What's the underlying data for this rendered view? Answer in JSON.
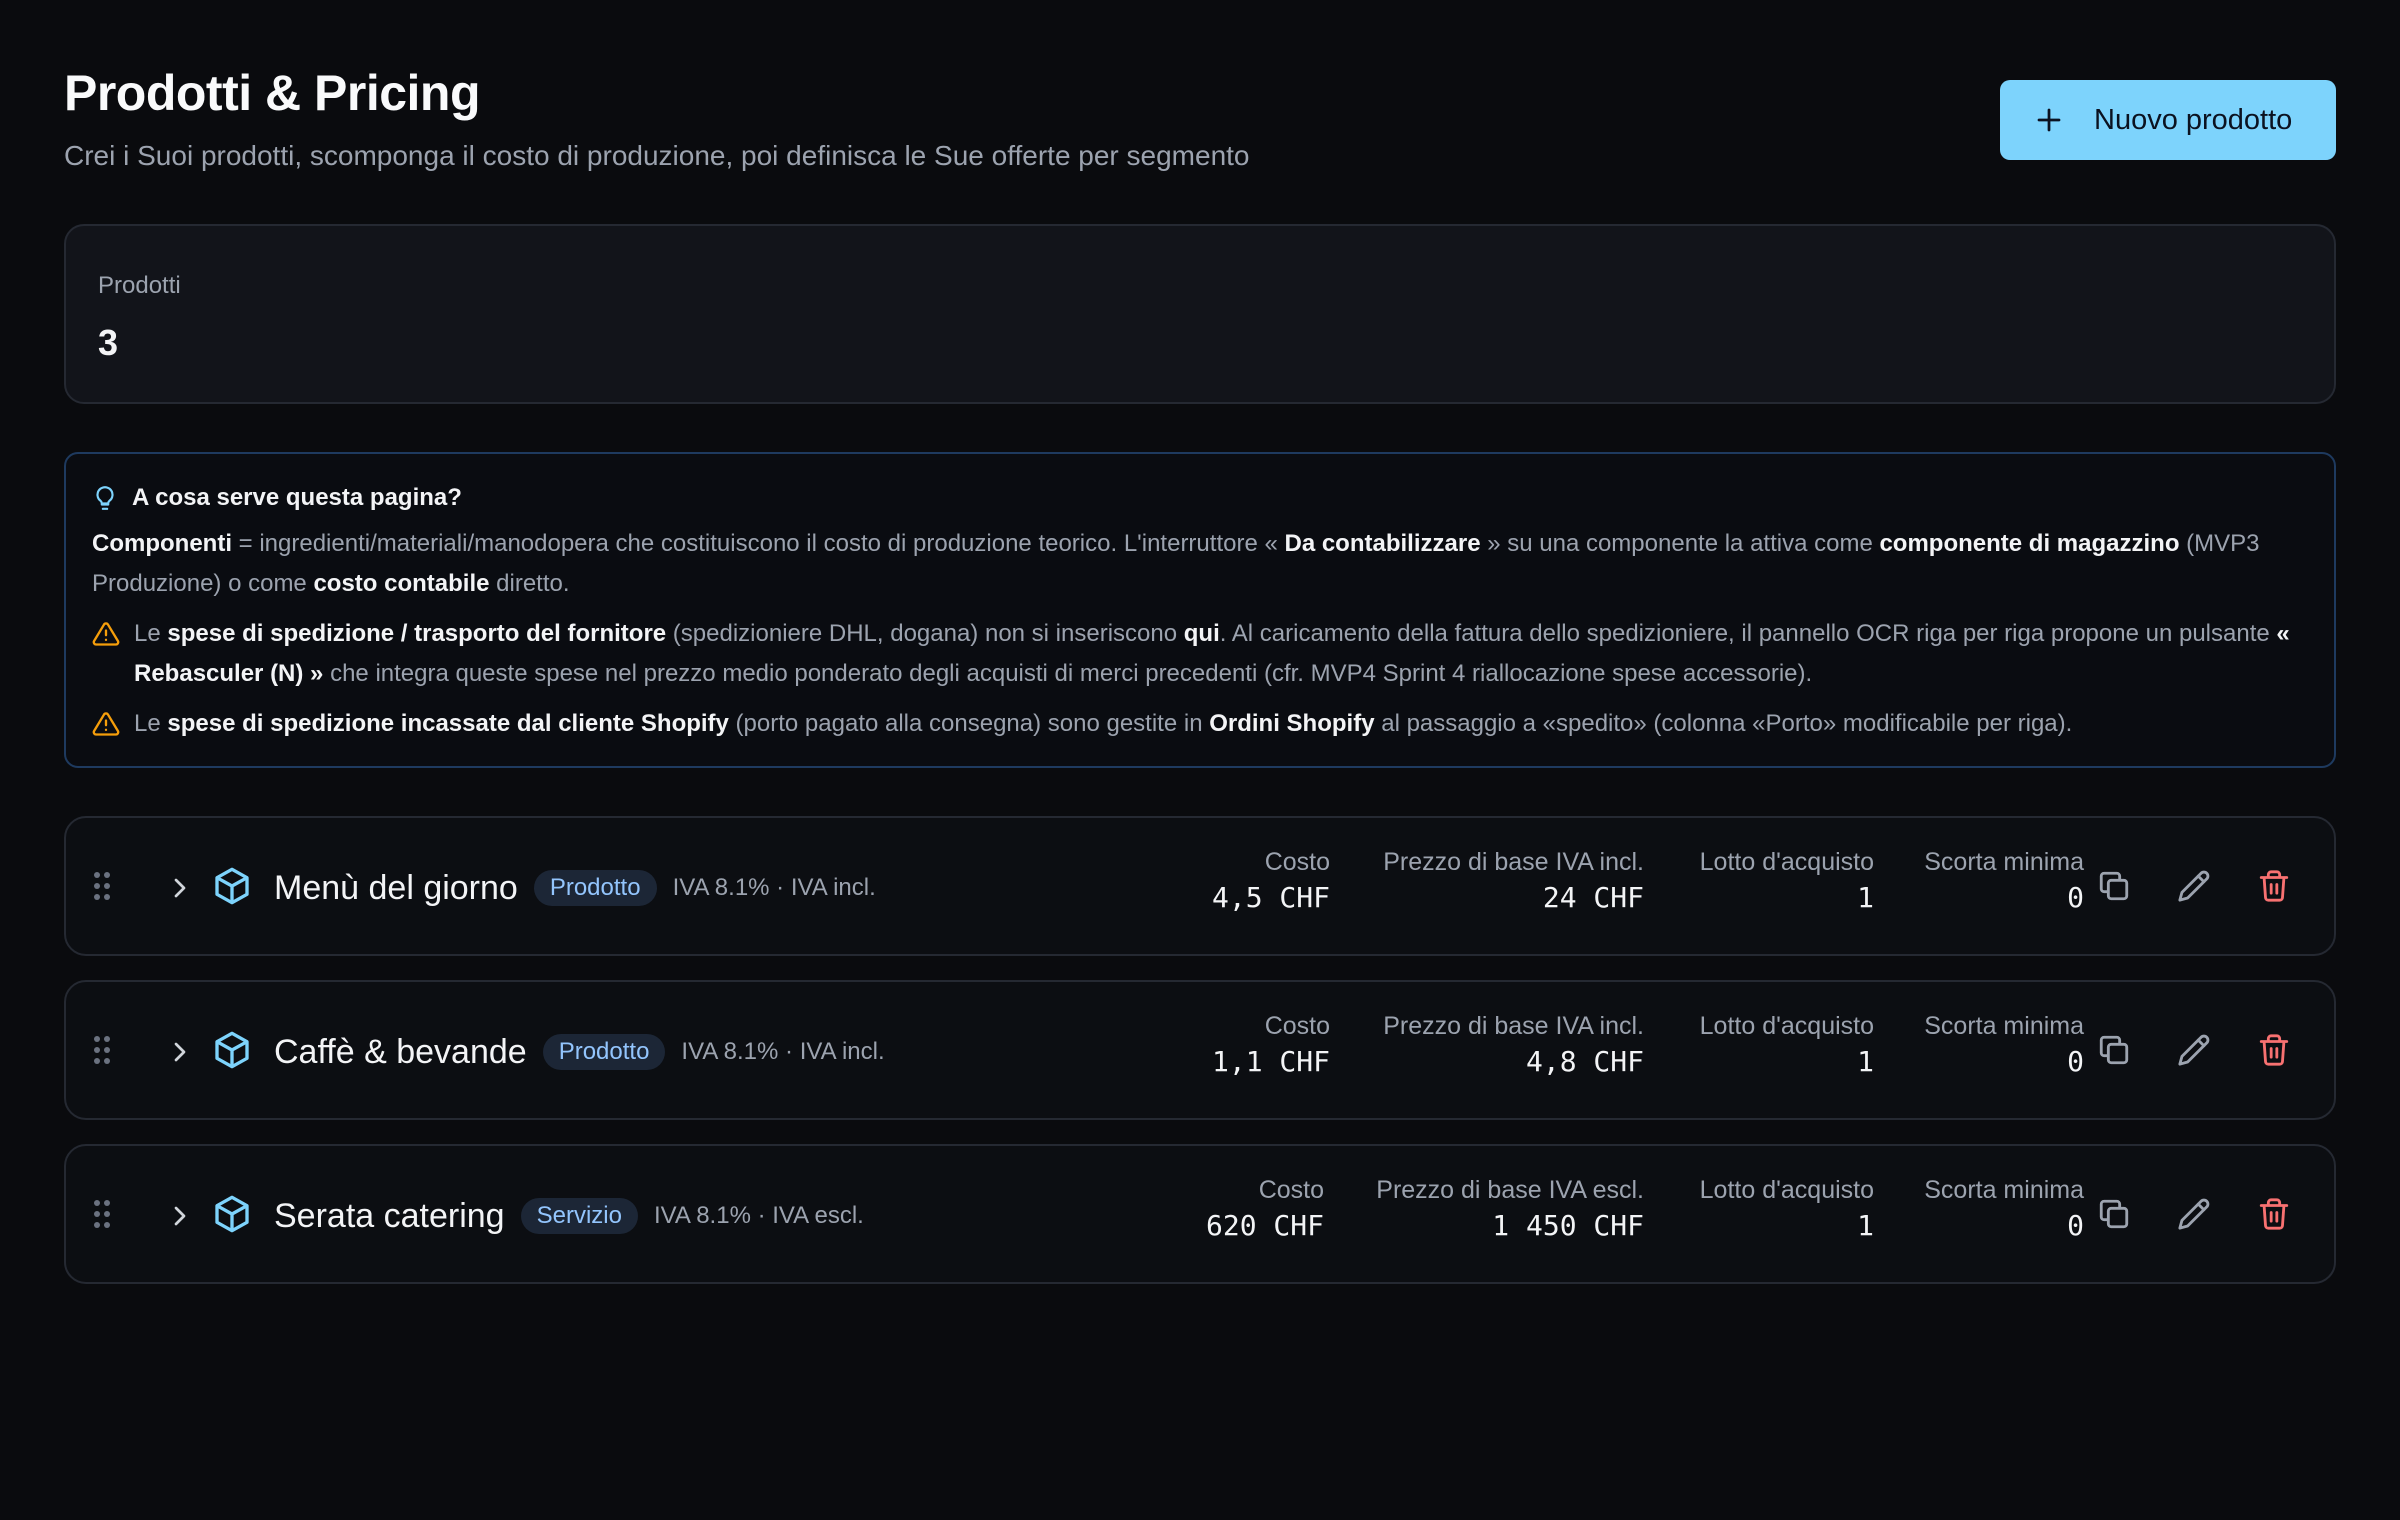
{
  "header": {
    "title": "Prodotti & Pricing",
    "subtitle": "Crei i Suoi prodotti, scomponga il costo di produzione, poi definisca le Sue offerte per segmento",
    "new_button": "Nuovo prodotto"
  },
  "stats": {
    "label": "Prodotti",
    "value": "3"
  },
  "info": {
    "title": "A cosa serve questa pagina?",
    "p1": {
      "t1": "Componenti",
      "t2": " = ingredienti/materiali/manodopera che costituiscono il costo di produzione teorico. L'interruttore « ",
      "t3": "Da contabilizzare",
      "t4": " » su una componente la attiva come ",
      "t5": "componente di magazzino",
      "t6": " (MVP3 Produzione) o come ",
      "t7": "costo contabile",
      "t8": " diretto."
    },
    "w1": {
      "t1": "Le ",
      "t2": "spese di spedizione / trasporto del fornitore",
      "t3": " (spedizioniere DHL, dogana) non si inseriscono ",
      "t4": "qui",
      "t5": ". Al caricamento della fattura dello spedizioniere, il pannello OCR riga per riga propone un pulsante ",
      "t6": "« Rebasculer (N) »",
      "t7": " che integra queste spese nel prezzo medio ponderato degli acquisti di merci precedenti (cfr. MVP4 Sprint 4 riallocazione spese accessorie)."
    },
    "w2": {
      "t1": "Le ",
      "t2": "spese di spedizione incassate dal cliente Shopify",
      "t3": " (porto pagato alla consegna) sono gestite in ",
      "t4": "Ordini Shopify",
      "t5": " al passaggio a «spedito» (colonna «Porto» modificabile per riga)."
    }
  },
  "products": [
    {
      "name": "Menù del giorno",
      "type": "Prodotto",
      "vat": "IVA 8.1% · IVA incl.",
      "cost_label": "Costo",
      "cost": "4,5 CHF",
      "price_label": "Prezzo di base IVA incl.",
      "price": "24 CHF",
      "lot_label": "Lotto d'acquisto",
      "lot": "1",
      "stock_label": "Scorta minima",
      "stock": "0"
    },
    {
      "name": "Caffè & bevande",
      "type": "Prodotto",
      "vat": "IVA 8.1% · IVA incl.",
      "cost_label": "Costo",
      "cost": "1,1 CHF",
      "price_label": "Prezzo di base IVA incl.",
      "price": "4,8 CHF",
      "lot_label": "Lotto d'acquisto",
      "lot": "1",
      "stock_label": "Scorta minima",
      "stock": "0"
    },
    {
      "name": "Serata catering",
      "type": "Servizio",
      "vat": "IVA 8.1% · IVA escl.",
      "cost_label": "Costo",
      "cost": "620 CHF",
      "price_label": "Prezzo di base IVA escl.",
      "price": "1 450 CHF",
      "lot_label": "Lotto d'acquisto",
      "lot": "1",
      "stock_label": "Scorta minima",
      "stock": "0"
    }
  ],
  "colors": {
    "accent": "#7dd3fc",
    "danger": "#f87171",
    "warning": "#f59e0b",
    "icon": "#7dd3fc"
  },
  "icons": {
    "new_button": "plus-icon",
    "info": "lightbulb-icon",
    "warning": "warning-triangle-icon",
    "drag": "drag-handle-icon",
    "expand": "chevron-right-icon",
    "product": "box-icon",
    "duplicate": "copy-icon",
    "edit": "pencil-icon",
    "delete": "trash-icon"
  }
}
